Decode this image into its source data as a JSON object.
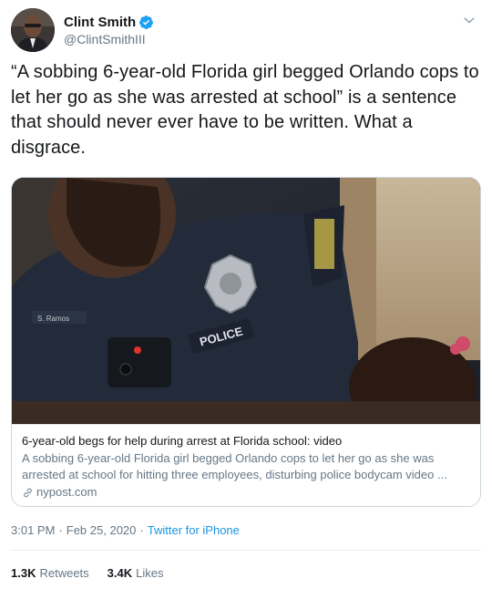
{
  "author": {
    "display_name": "Clint Smith",
    "handle": "@ClintSmithIII",
    "verified": true,
    "avatar_icon": "profile-photo"
  },
  "tweet": {
    "text": "“A sobbing 6-year-old Florida girl begged Orlando cops to let her go as she was arrested at school” is a sentence that should never ever have to be written. What a disgrace."
  },
  "card": {
    "title": "6-year-old begs for help during arrest at Florida school: video",
    "description": "A sobbing 6-year-old Florida girl begged Orlando cops to let her go as she was arrested at school for hitting three employees, disturbing police bodycam video ...",
    "domain": "nypost.com",
    "image_caption_badge": "POLICE",
    "image_nametag": "S. Ramos"
  },
  "meta": {
    "time": "3:01 PM",
    "separator1": "·",
    "date": "Feb 25, 2020",
    "separator2": "·",
    "source": "Twitter for iPhone"
  },
  "stats": {
    "retweets_count": "1.3K",
    "retweets_label": "Retweets",
    "likes_count": "3.4K",
    "likes_label": "Likes"
  },
  "colors": {
    "link_blue": "#1b95e0",
    "verified_blue": "#1da1f2",
    "secondary_text": "#657786",
    "border": "#ccd6dd"
  }
}
